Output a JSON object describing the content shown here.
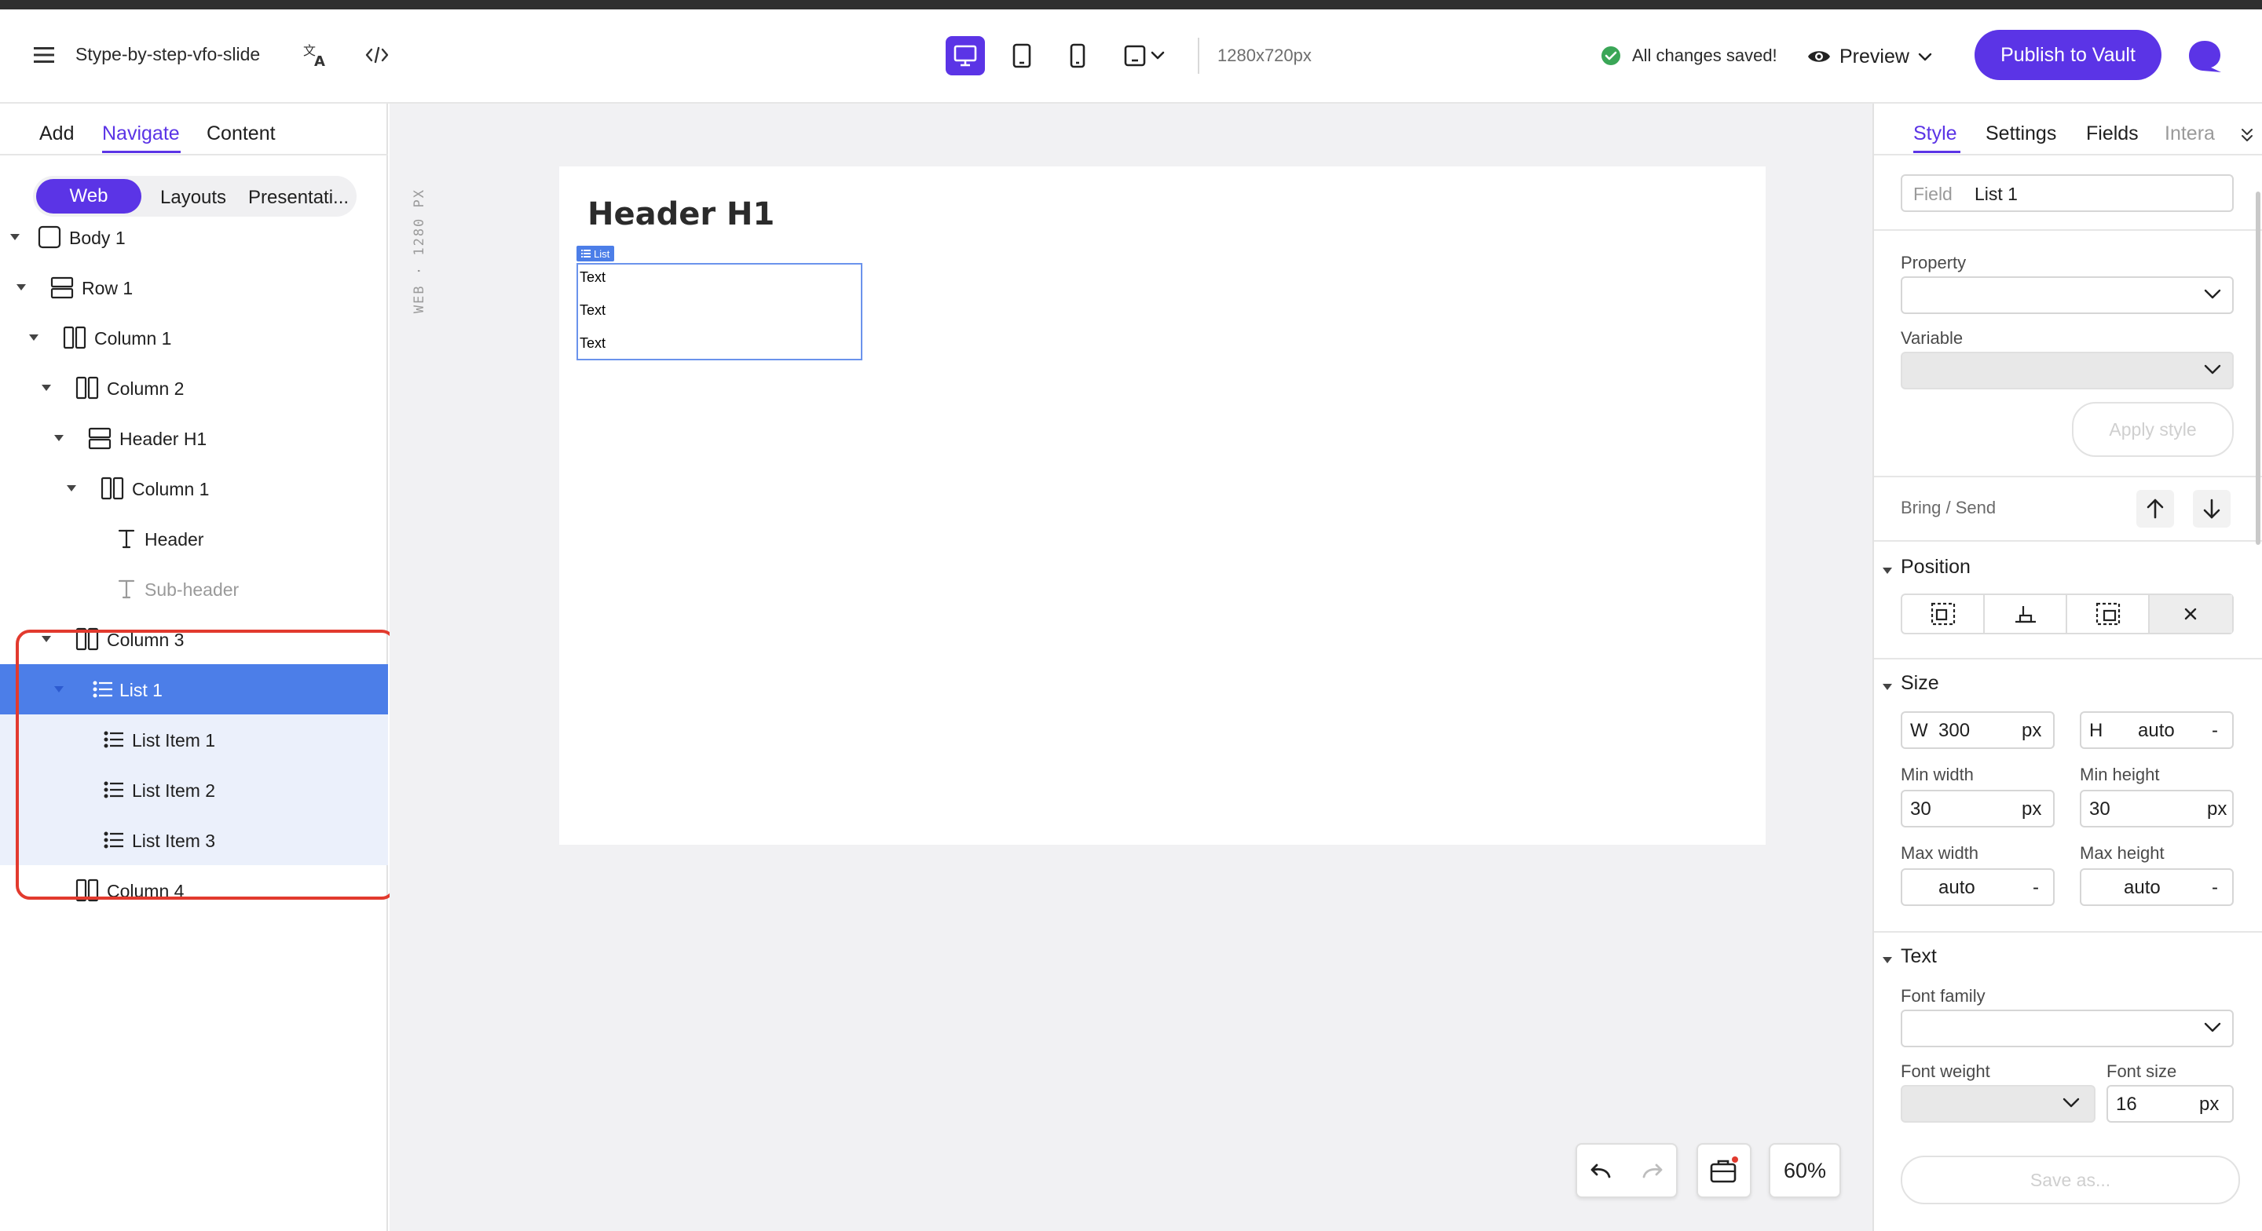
{
  "topbar": {
    "project_name": "Stype-by-step-vfo-slide",
    "resolution": "1280x720px",
    "save_status": "All changes saved!",
    "preview_label": "Preview",
    "publish_label": "Publish to Vault"
  },
  "left": {
    "tabs": [
      "Add",
      "Navigate",
      "Content"
    ],
    "active_tab": "Navigate",
    "segments": [
      "Web",
      "Layouts",
      "Presentati..."
    ],
    "active_segment": "Web",
    "tree": [
      {
        "label": "Body 1",
        "icon": "body-icon",
        "state": "normal"
      },
      {
        "label": "Row 1",
        "icon": "row-icon",
        "state": "normal"
      },
      {
        "label": "Column 1",
        "icon": "column-icon",
        "state": "normal"
      },
      {
        "label": "Column 2",
        "icon": "column-icon",
        "state": "normal"
      },
      {
        "label": "Header H1",
        "icon": "row-icon",
        "state": "normal"
      },
      {
        "label": "Column 1",
        "icon": "column-icon",
        "state": "normal"
      },
      {
        "label": "Header",
        "icon": "text-icon",
        "state": "normal"
      },
      {
        "label": "Sub-header",
        "icon": "text-icon",
        "state": "dim"
      },
      {
        "label": "Column 3",
        "icon": "column-icon",
        "state": "normal"
      },
      {
        "label": "List 1",
        "icon": "list-icon",
        "state": "selected"
      },
      {
        "label": "List Item 1",
        "icon": "list-icon",
        "state": "child"
      },
      {
        "label": "List Item 2",
        "icon": "list-icon",
        "state": "child"
      },
      {
        "label": "List Item 3",
        "icon": "list-icon",
        "state": "child"
      },
      {
        "label": "Column 4",
        "icon": "column-icon",
        "state": "normal"
      }
    ]
  },
  "canvas": {
    "ruler_label": "WEB · 1280 PX",
    "header_text": "Header H1",
    "list_tag": "List",
    "list_items": [
      "Text",
      "Text",
      "Text"
    ],
    "zoom": "60%"
  },
  "right": {
    "tabs": [
      "Style",
      "Settings",
      "Fields",
      "Intera"
    ],
    "active_tab": "Style",
    "field_label": "Field",
    "field_value": "List 1",
    "property_label": "Property",
    "variable_label": "Variable",
    "apply_style": "Apply style",
    "bring_send": "Bring / Send",
    "position_title": "Position",
    "size_title": "Size",
    "width_prefix": "W",
    "width_value": "300",
    "width_unit": "px",
    "height_prefix": "H",
    "height_value": "auto",
    "height_unit": "-",
    "min_width_label": "Min width",
    "min_width_value": "30",
    "min_width_unit": "px",
    "min_height_label": "Min height",
    "min_height_value": "30",
    "min_height_unit": "px",
    "max_width_label": "Max width",
    "max_width_value": "auto",
    "max_width_unit": "-",
    "max_height_label": "Max height",
    "max_height_value": "auto",
    "max_height_unit": "-",
    "text_title": "Text",
    "font_family_label": "Font family",
    "font_weight_label": "Font weight",
    "font_size_label": "Font size",
    "font_size_value": "16",
    "font_size_unit": "px",
    "save_as": "Save as..."
  },
  "colors": {
    "accent": "#5b34e6",
    "selection": "#4c7ee8",
    "highlight_border": "#e23a2e",
    "success": "#3aa657"
  }
}
